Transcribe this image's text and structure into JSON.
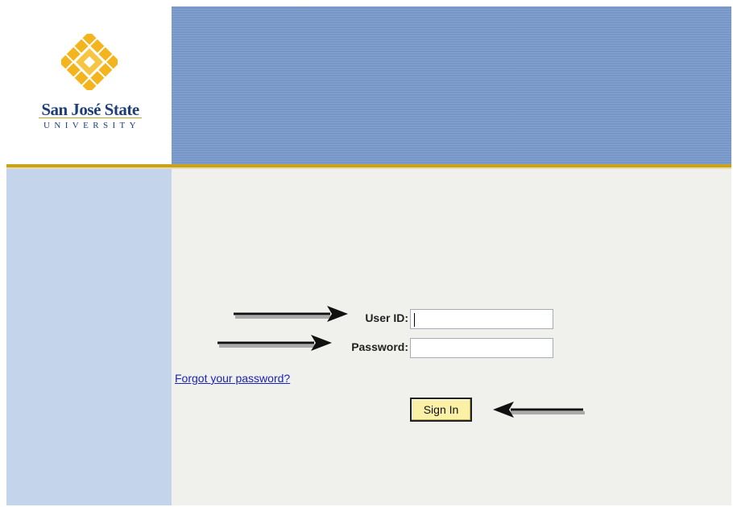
{
  "brand": {
    "name": "San José State",
    "subtitle": "UNIVERSITY",
    "colors": {
      "gold": "#f4b41e",
      "navy": "#1f3f7a",
      "banner": "#7796c8",
      "rule": "#c9a21c"
    }
  },
  "form": {
    "user_id_label": "User ID:",
    "user_id_value": "",
    "password_label": "Password:",
    "password_value": "",
    "forgot_link": "Forgot your password?",
    "signin_label": "Sign In"
  },
  "annotations": {
    "arrows": [
      "arrow-right-icon",
      "arrow-right-icon",
      "arrow-left-icon"
    ]
  }
}
